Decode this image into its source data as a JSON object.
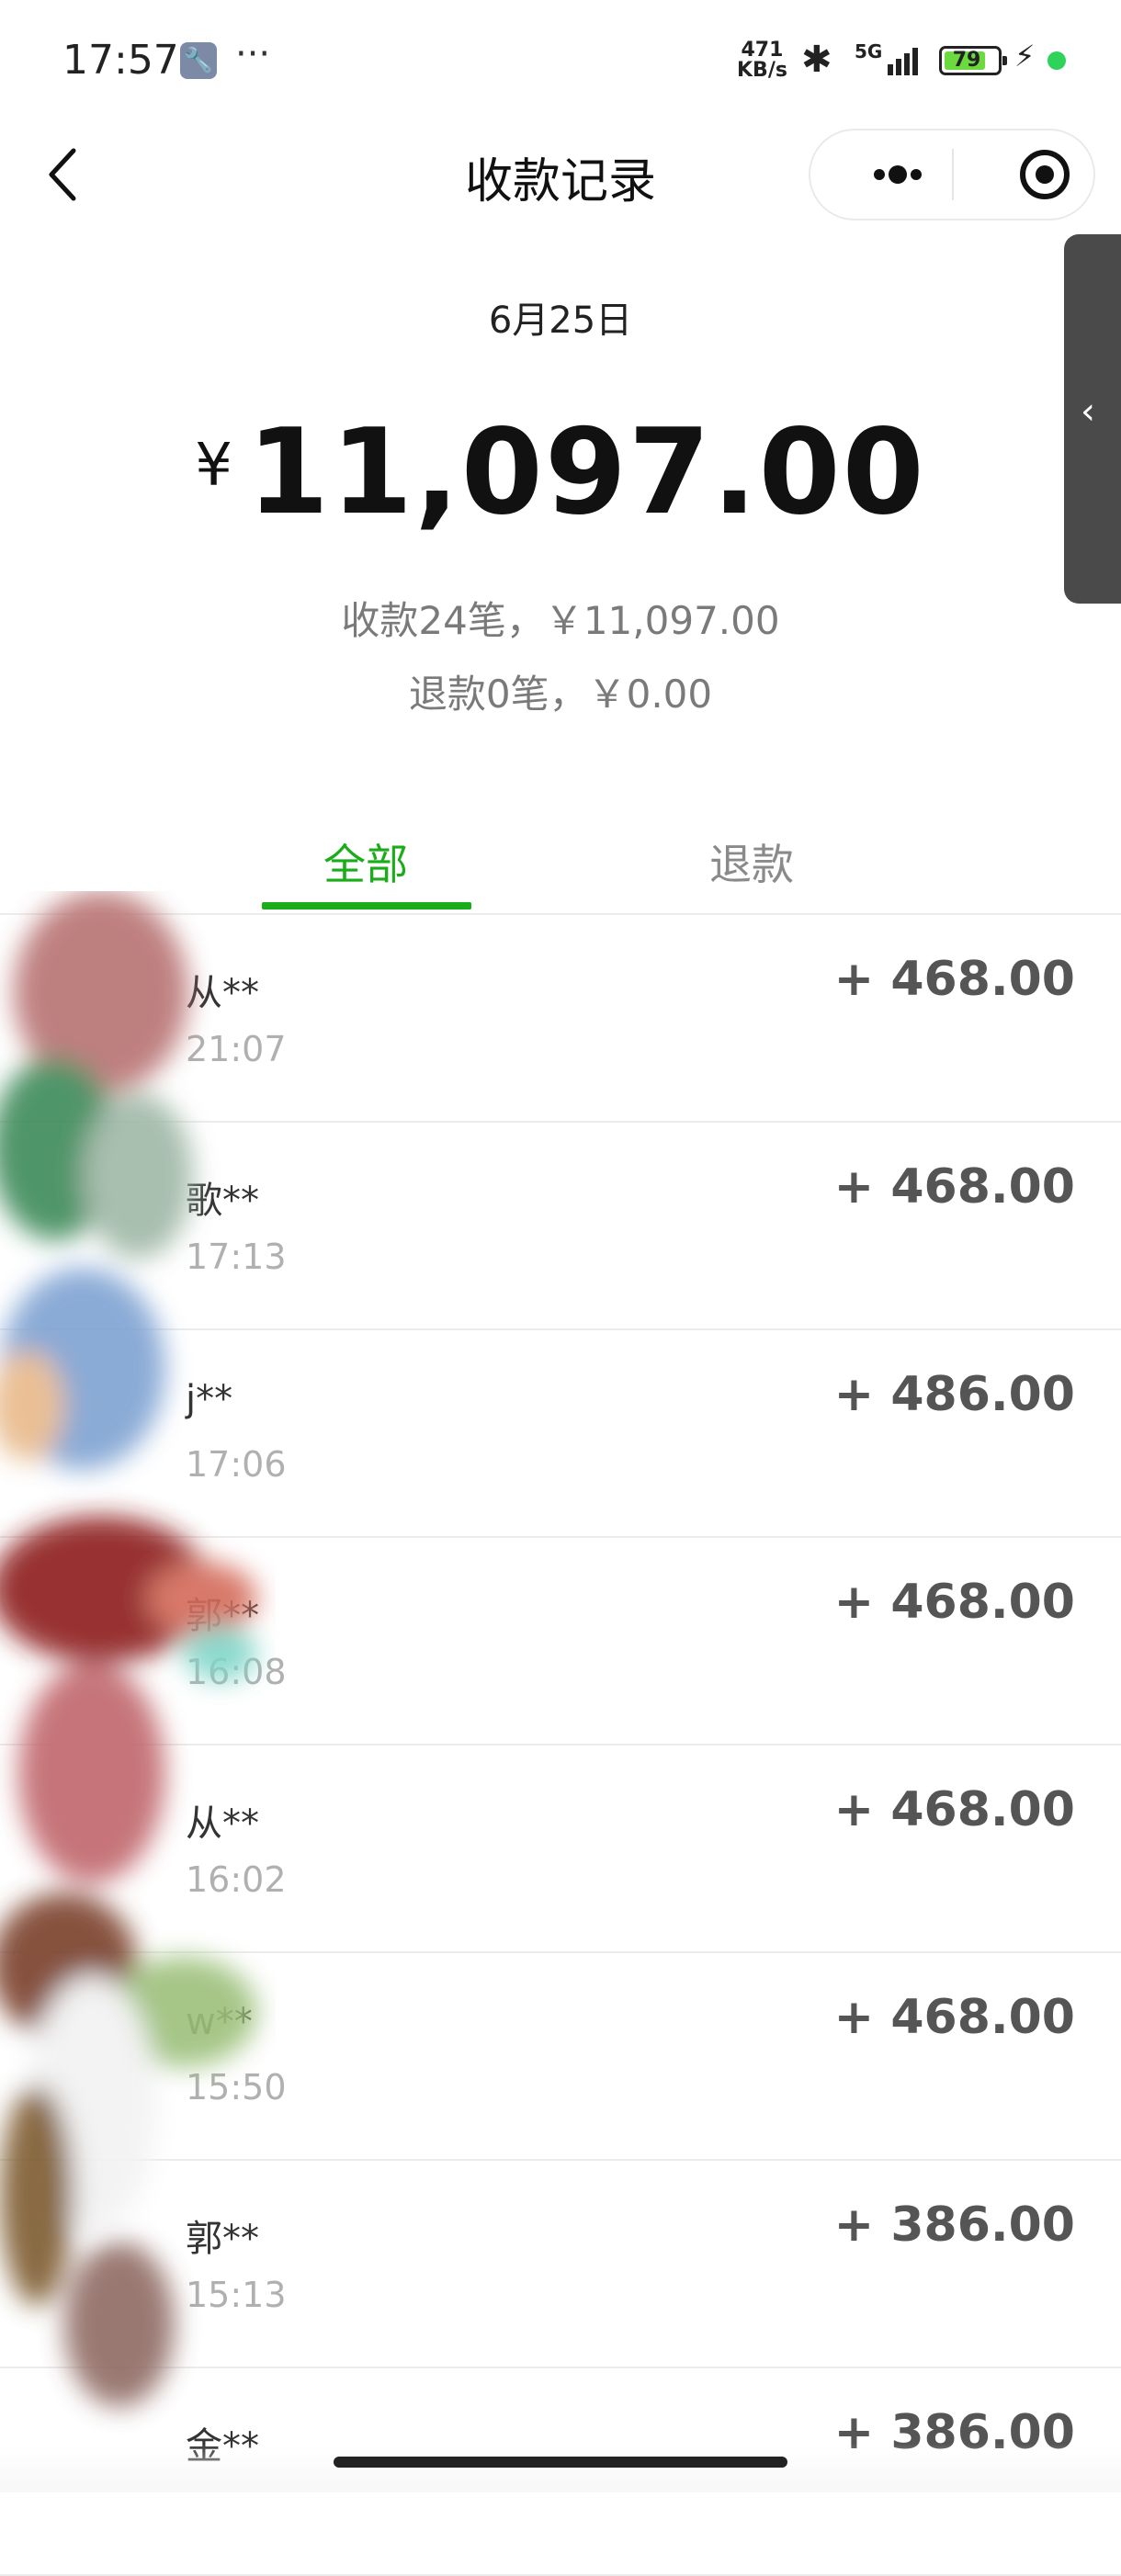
{
  "status_bar": {
    "time": "17:57",
    "speed_value": "471",
    "speed_unit": "KB/s",
    "network": "5G",
    "battery": "79",
    "battery_level": 0.79
  },
  "nav": {
    "title": "收款记录",
    "back_icon": "chevron-left-icon",
    "more_icon": "more-dots-icon",
    "close_icon": "target-icon"
  },
  "summary": {
    "date": "6月25日",
    "currency": "¥",
    "total": "11,097.00",
    "income_line": "收款24笔，￥11,097.00",
    "refund_line": "退款0笔，￥0.00"
  },
  "tabs": [
    {
      "label": "全部",
      "active": true
    },
    {
      "label": "退款",
      "active": false
    }
  ],
  "records": [
    {
      "name": "从**",
      "time": "21:07",
      "amount": "+ 468.00"
    },
    {
      "name": "歌**",
      "time": "17:13",
      "amount": "+ 468.00"
    },
    {
      "name": "j**",
      "time": "17:06",
      "amount": "+ 486.00"
    },
    {
      "name": "郭**",
      "time": "16:08",
      "amount": "+ 468.00"
    },
    {
      "name": "从**",
      "time": "16:02",
      "amount": "+ 468.00"
    },
    {
      "name": "w**",
      "time": "15:50",
      "amount": "+ 468.00"
    },
    {
      "name": "郭**",
      "time": "15:13",
      "amount": "+ 386.00"
    },
    {
      "name": "金**",
      "time": "",
      "amount": "+ 386.00"
    }
  ],
  "colors": {
    "accent": "#1aad19",
    "amount": "#555555",
    "muted": "#7a7a7a"
  }
}
